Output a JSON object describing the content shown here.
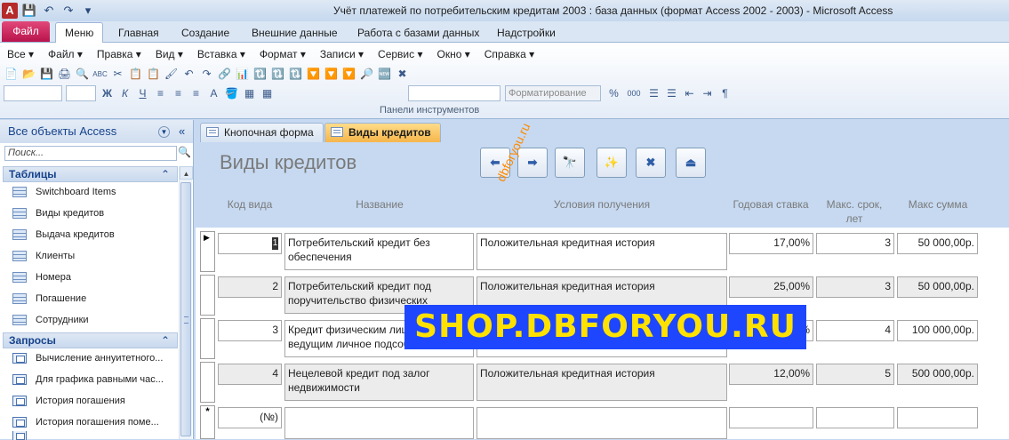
{
  "window": {
    "title": "Учёт платежей по потребительским кредитам 2003 : база данных (формат Access 2002 - 2003)  -  Microsoft Access"
  },
  "quick_access": [
    "app-icon",
    "save-icon",
    "undo-icon",
    "redo-icon",
    "customize-icon"
  ],
  "ribbon": {
    "file_tab": "Файл",
    "tabs": [
      "Меню",
      "Главная",
      "Создание",
      "Внешние данные",
      "Работа с базами данных",
      "Надстройки"
    ],
    "active_tab": "Меню",
    "menu": [
      "Все ▾",
      "Файл ▾",
      "Правка ▾",
      "Вид ▾",
      "Вставка ▾",
      "Формат ▾",
      "Записи ▾",
      "Сервис ▾",
      "Окно ▾",
      "Справка ▾"
    ],
    "format_combo": "Форматирование",
    "group_label": "Панели инструментов",
    "toolbar_row1": [
      "📄",
      "📂",
      "💾",
      "🖨",
      "🔍",
      "ABC",
      "✂",
      "📋",
      "📋",
      "🖌",
      "↶",
      "↷",
      "🔗",
      "📊",
      "🔃",
      "🔃",
      "🔃",
      "🔽",
      "🔽",
      "🔽",
      "🔎",
      "🆕",
      "✖"
    ],
    "toolbar_row2": [
      "Ж",
      "К",
      "Ч",
      "≡",
      "≡",
      "≡",
      "A",
      "🪣",
      "▦",
      "▦",
      "%",
      "000",
      "☰",
      "☰",
      "⇤",
      "⇥",
      "¶"
    ]
  },
  "nav": {
    "header": "Все объекты Access",
    "search_placeholder": "Поиск...",
    "groups": [
      {
        "title": "Таблицы",
        "items": [
          "Switchboard Items",
          "Виды кредитов",
          "Выдача кредитов",
          "Клиенты",
          "Номера",
          "Погашение",
          "Сотрудники"
        ]
      },
      {
        "title": "Запросы",
        "items": [
          "Вычисление аннуитетного...",
          "Для графика равными час...",
          "История погашения",
          "История погашения поме..."
        ]
      }
    ]
  },
  "doc_tabs": [
    {
      "label": "Кнопочная форма",
      "active": false
    },
    {
      "label": "Виды кредитов",
      "active": true
    }
  ],
  "form": {
    "title": "Виды кредитов",
    "buttons": [
      "prev-record",
      "next-record",
      "find",
      "new-record",
      "delete-record",
      "close-form"
    ],
    "button_glyphs": [
      "⬅",
      "➡",
      "🔭",
      "✨",
      "✖",
      "⏏"
    ],
    "columns": [
      "Код вида",
      "Название",
      "Условия получения",
      "Годовая ставка",
      "Макс. срок, лет",
      "Макс сумма"
    ],
    "records": [
      {
        "code": "1",
        "name": "Потребительский кредит без обеспечения",
        "conditions": "Положительная кредитная история",
        "rate": "17,00%",
        "term": "3",
        "max_sum": "50 000,00р.",
        "current": true
      },
      {
        "code": "2",
        "name": "Потребительский кредит под поручительство физических",
        "conditions": "Положительная кредитная история",
        "rate": "25,00%",
        "term": "3",
        "max_sum": "50 000,00р.",
        "current": false
      },
      {
        "code": "3",
        "name": "Кредит физическим лицам, ведущим личное подсобное",
        "conditions": "",
        "rate": "%",
        "term": "4",
        "max_sum": "100 000,00р.",
        "current": false
      },
      {
        "code": "4",
        "name": "Нецелевой кредит под залог недвижимости",
        "conditions": "Положительная кредитная история",
        "rate": "12,00%",
        "term": "5",
        "max_sum": "500 000,00р.",
        "current": false
      }
    ],
    "new_record_marker": "*",
    "new_record_code": "(№)"
  },
  "overlays": {
    "banner": "SHOP.DBFORYOU.RU",
    "diagonal": "dbforyou.ru"
  },
  "colors": {
    "banner_bg": "#1e46ff",
    "banner_fg": "#ffe100",
    "active_doc_tab": "#f5b54a",
    "file_tab": "#c71c58"
  }
}
